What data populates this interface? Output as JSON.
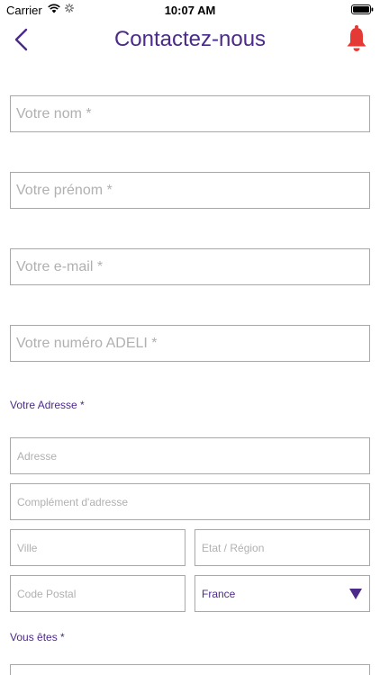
{
  "status_bar": {
    "carrier": "Carrier",
    "time": "10:07 AM"
  },
  "header": {
    "title": "Contactez-nous"
  },
  "form": {
    "last_name_placeholder": "Votre nom *",
    "first_name_placeholder": "Votre prénom *",
    "email_placeholder": "Votre e-mail *",
    "adeli_placeholder": "Votre numéro ADELI *",
    "address_section_label": "Votre Adresse *",
    "address_placeholder": "Adresse",
    "address_complement_placeholder": "Complément d'adresse",
    "city_placeholder": "Ville",
    "state_placeholder": "Etat / Région",
    "postal_code_placeholder": "Code Postal",
    "country_selected": "France",
    "you_are_label": "Vous êtes *"
  },
  "colors": {
    "accent": "#4b2a8a",
    "bell": "#e53935",
    "border": "#a8a8a8"
  }
}
